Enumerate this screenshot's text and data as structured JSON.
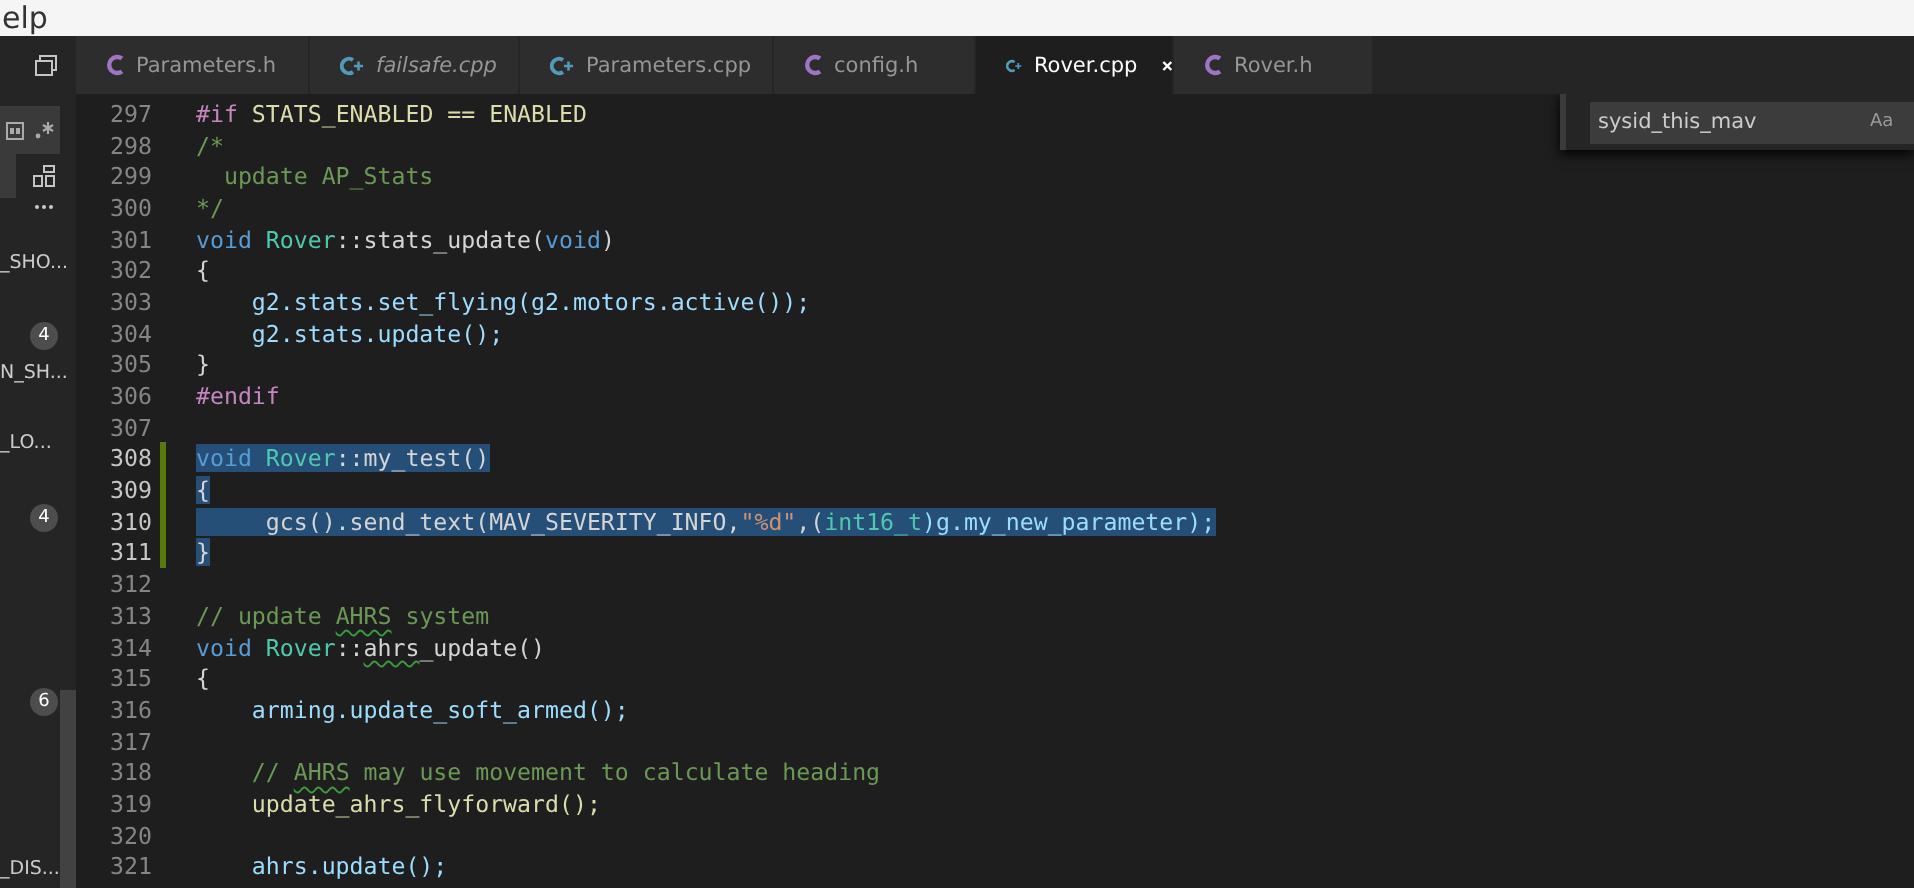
{
  "menu_bar": {
    "items": [
      "elp"
    ]
  },
  "sidebar": {
    "items": [
      {
        "kind": "label",
        "text": "_SHO..."
      },
      {
        "kind": "badge",
        "text": "4"
      },
      {
        "kind": "label",
        "text": "N_SH..."
      },
      {
        "kind": "label",
        "text": "_LO..."
      },
      {
        "kind": "badge",
        "text": "4"
      },
      {
        "kind": "badge",
        "text": "6"
      },
      {
        "kind": "label",
        "text": "_DIS..."
      }
    ]
  },
  "tabs": [
    {
      "label": "Parameters.h",
      "kind": "c",
      "selected": false,
      "preview": false
    },
    {
      "label": "failsafe.cpp",
      "kind": "cpp",
      "selected": false,
      "preview": true
    },
    {
      "label": "Parameters.cpp",
      "kind": "cpp",
      "selected": false,
      "preview": false
    },
    {
      "label": "config.h",
      "kind": "c",
      "selected": false,
      "preview": false
    },
    {
      "label": "Rover.cpp",
      "kind": "cpp",
      "selected": true,
      "preview": false
    },
    {
      "label": "Rover.h",
      "kind": "c",
      "selected": false,
      "preview": false
    }
  ],
  "find_widget": {
    "value": "sysid_this_mav",
    "match_case": "Aa"
  },
  "editor": {
    "lines": [
      {
        "number": "297",
        "selected": false,
        "modified": false,
        "tokens": [
          {
            "kind": "preproc",
            "text": "#if"
          },
          {
            "kind": "macro",
            "text": " STATS_ENABLED == ENABLED"
          }
        ]
      },
      {
        "number": "298",
        "selected": false,
        "modified": false,
        "tokens": [
          {
            "kind": "comment",
            "text": "/*"
          }
        ]
      },
      {
        "number": "299",
        "selected": false,
        "modified": false,
        "tokens": [
          {
            "kind": "comment",
            "text": "  update AP_Stats"
          }
        ]
      },
      {
        "number": "300",
        "selected": false,
        "modified": false,
        "tokens": [
          {
            "kind": "comment",
            "text": "*/"
          }
        ]
      },
      {
        "number": "301",
        "selected": false,
        "modified": false,
        "tokens": [
          {
            "kind": "keyword",
            "text": "void"
          },
          {
            "kind": "type",
            "text": " Rover"
          },
          {
            "kind": "plain",
            "text": "::stats_update("
          },
          {
            "kind": "keyword",
            "text": "void"
          },
          {
            "kind": "plain",
            "text": ")"
          }
        ]
      },
      {
        "number": "302",
        "selected": false,
        "modified": false,
        "tokens": [
          {
            "kind": "plain",
            "text": "{"
          }
        ]
      },
      {
        "number": "303",
        "selected": false,
        "modified": false,
        "tokens": [
          {
            "kind": "variable",
            "text": "    g2.stats.set_flying(g2.motors.active());"
          }
        ]
      },
      {
        "number": "304",
        "selected": false,
        "modified": false,
        "tokens": [
          {
            "kind": "variable",
            "text": "    g2.stats.update();"
          }
        ]
      },
      {
        "number": "305",
        "selected": false,
        "modified": false,
        "tokens": [
          {
            "kind": "plain",
            "text": "}"
          }
        ]
      },
      {
        "number": "306",
        "selected": false,
        "modified": false,
        "tokens": [
          {
            "kind": "preproc",
            "text": "#endif"
          }
        ]
      },
      {
        "number": "307",
        "selected": false,
        "modified": false
      },
      {
        "number": "308",
        "selected": true,
        "modified": true,
        "tokens": [
          {
            "kind": "keyword",
            "text": "void"
          },
          {
            "kind": "type",
            "text": " Rover"
          },
          {
            "kind": "plain",
            "text": "::my_test()"
          }
        ]
      },
      {
        "number": "309",
        "selected": true,
        "modified": true,
        "tokens": [
          {
            "kind": "plain",
            "text": "{"
          }
        ]
      },
      {
        "number": "310",
        "selected": true,
        "modified": true,
        "tokens": [
          {
            "kind": "plain",
            "text": "     gcs().send_text(MAV_SEVERITY_INFO,"
          },
          {
            "kind": "string",
            "text": "\"%d\""
          },
          {
            "kind": "plain",
            "text": ",("
          },
          {
            "kind": "type",
            "text": "int16_t"
          },
          {
            "kind": "variable",
            "text": ")g.my_new_parameter);"
          }
        ]
      },
      {
        "number": "311",
        "selected": true,
        "modified": true,
        "tokens": [
          {
            "kind": "plain",
            "text": "}"
          }
        ]
      },
      {
        "number": "312",
        "selected": false,
        "modified": false
      },
      {
        "number": "313",
        "selected": false,
        "modified": false,
        "tokens": [
          {
            "kind": "comment",
            "text": "// update "
          },
          {
            "kind": "comment",
            "text": "AHRS",
            "squiggle": true
          },
          {
            "kind": "comment",
            "text": " system"
          }
        ]
      },
      {
        "number": "314",
        "selected": false,
        "modified": false,
        "tokens": [
          {
            "kind": "keyword",
            "text": "void"
          },
          {
            "kind": "type",
            "text": " Rover"
          },
          {
            "kind": "plain",
            "text": "::"
          },
          {
            "kind": "plain",
            "text": "ahrs",
            "squiggle": true
          },
          {
            "kind": "plain",
            "text": "_update()"
          }
        ]
      },
      {
        "number": "315",
        "selected": false,
        "modified": false,
        "tokens": [
          {
            "kind": "plain",
            "text": "{"
          }
        ]
      },
      {
        "number": "316",
        "selected": false,
        "modified": false,
        "tokens": [
          {
            "kind": "variable",
            "text": "    arming.update_soft_armed();"
          }
        ]
      },
      {
        "number": "317",
        "selected": false,
        "modified": false
      },
      {
        "number": "318",
        "selected": false,
        "modified": false,
        "tokens": [
          {
            "kind": "comment",
            "text": "    // "
          },
          {
            "kind": "comment",
            "text": "AHRS",
            "squiggle": true
          },
          {
            "kind": "comment",
            "text": " may use movement to calculate heading"
          }
        ]
      },
      {
        "number": "319",
        "selected": false,
        "modified": false,
        "tokens": [
          {
            "kind": "function",
            "text": "    update_ahrs_flyforward();"
          }
        ]
      },
      {
        "number": "320",
        "selected": false,
        "modified": false
      },
      {
        "number": "321",
        "selected": false,
        "modified": false,
        "tokens": [
          {
            "kind": "variable",
            "text": "    ahrs.update();"
          }
        ]
      }
    ]
  }
}
